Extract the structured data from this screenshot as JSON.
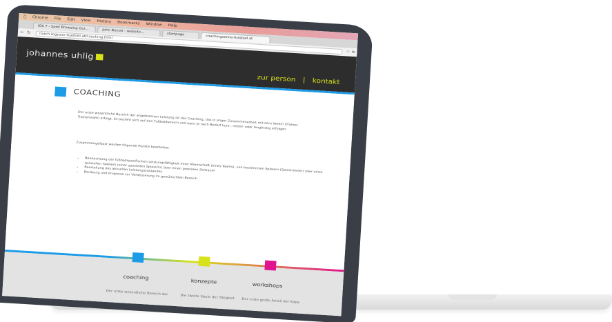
{
  "browser": {
    "menu": [
      "Chrome",
      "File",
      "Edit",
      "View",
      "History",
      "Bookmarks",
      "Window",
      "Help"
    ],
    "tabs": [
      "iOS 7 - Spiel Browsing Gui...",
      "John Benoit - website...",
      "startpage",
      "coachingszene-fussball.at"
    ],
    "url": "coach.mgzone-fussball.at/coaching.html"
  },
  "site": {
    "logo": "johannes uhlig",
    "nav": {
      "person": "zur person",
      "separator": "|",
      "kontakt": "kontakt"
    },
    "section_title": "COACHING",
    "intro": "Der erste wesentliche Bereich der angebotenen Leistung ist das Coaching, das in enger Zusammenarbeit mit dem Verein (Trainer, Trainerteam) erfolgt. Es bezieht sich auf den Fußballbereich und kann je nach Bedarf kurz-, mittel- oder langfristig erfolgen.",
    "summary": "Zusammengefasst werden folgende Punkte bearbeitet:",
    "bullets": [
      "Beobachtung der fußballspezifischen Leistungsfähigkeit einer Mannschaft (eines Teams), von bestimmten Spielern (Spielerinnen) oder eines speziellen Spielers (einer speziellen Spielerin) über einen gewissen Zeitraum",
      "Beurteilung des aktuellen Leistungszustandes",
      "Beratung und Prognose zur Verbesserung im gewünschten Bereich"
    ],
    "footer": [
      {
        "label": "coaching",
        "text": "Der erste wesentliche Bereich der",
        "color": "#1c9be6"
      },
      {
        "label": "konzepte",
        "text": "Die zweite Säule der Tätigkeit",
        "color": "#d8e21a"
      },
      {
        "label": "workshops",
        "text": "Der erste große Anteil der Kapa",
        "color": "#e0148f"
      }
    ]
  },
  "colors": {
    "accent_blue": "#1c9be6",
    "accent_yellow": "#d8e21a",
    "accent_magenta": "#e0148f",
    "header_bg": "#2d2d2d"
  }
}
